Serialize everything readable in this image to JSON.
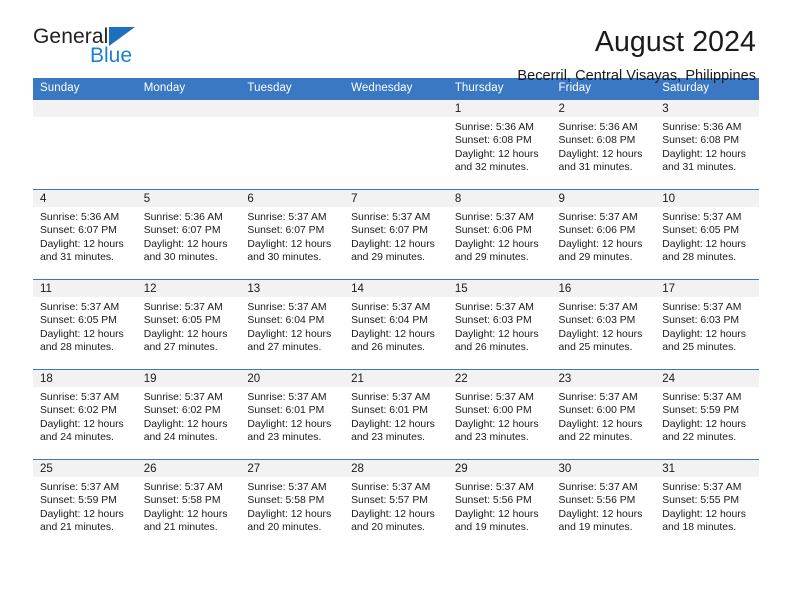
{
  "brand": {
    "name_part1": "General",
    "name_part2": "Blue",
    "triangle_color": "#1e6fbd",
    "blue_text_color": "#1e7fd4"
  },
  "header": {
    "title": "August 2024",
    "subtitle": "Becerril, Central Visayas, Philippines"
  },
  "theme": {
    "header_blue": "#3b78c3",
    "daynum_band": "#f2f2f2",
    "text": "#1a1a1a"
  },
  "weekday_headers": [
    "Sunday",
    "Monday",
    "Tuesday",
    "Wednesday",
    "Thursday",
    "Friday",
    "Saturday"
  ],
  "chart_data": {
    "type": "table",
    "title": "August 2024",
    "subtitle": "Becerril, Central Visayas, Philippines",
    "columns": [
      "Sunday",
      "Monday",
      "Tuesday",
      "Wednesday",
      "Thursday",
      "Friday",
      "Saturday"
    ],
    "weeks": [
      [
        {
          "day": "",
          "empty": true
        },
        {
          "day": "",
          "empty": true
        },
        {
          "day": "",
          "empty": true
        },
        {
          "day": "",
          "empty": true
        },
        {
          "day": "1",
          "sunrise": "Sunrise: 5:36 AM",
          "sunset": "Sunset: 6:08 PM",
          "daylight1": "Daylight: 12 hours",
          "daylight2": "and 32 minutes."
        },
        {
          "day": "2",
          "sunrise": "Sunrise: 5:36 AM",
          "sunset": "Sunset: 6:08 PM",
          "daylight1": "Daylight: 12 hours",
          "daylight2": "and 31 minutes."
        },
        {
          "day": "3",
          "sunrise": "Sunrise: 5:36 AM",
          "sunset": "Sunset: 6:08 PM",
          "daylight1": "Daylight: 12 hours",
          "daylight2": "and 31 minutes."
        }
      ],
      [
        {
          "day": "4",
          "sunrise": "Sunrise: 5:36 AM",
          "sunset": "Sunset: 6:07 PM",
          "daylight1": "Daylight: 12 hours",
          "daylight2": "and 31 minutes."
        },
        {
          "day": "5",
          "sunrise": "Sunrise: 5:36 AM",
          "sunset": "Sunset: 6:07 PM",
          "daylight1": "Daylight: 12 hours",
          "daylight2": "and 30 minutes."
        },
        {
          "day": "6",
          "sunrise": "Sunrise: 5:37 AM",
          "sunset": "Sunset: 6:07 PM",
          "daylight1": "Daylight: 12 hours",
          "daylight2": "and 30 minutes."
        },
        {
          "day": "7",
          "sunrise": "Sunrise: 5:37 AM",
          "sunset": "Sunset: 6:07 PM",
          "daylight1": "Daylight: 12 hours",
          "daylight2": "and 29 minutes."
        },
        {
          "day": "8",
          "sunrise": "Sunrise: 5:37 AM",
          "sunset": "Sunset: 6:06 PM",
          "daylight1": "Daylight: 12 hours",
          "daylight2": "and 29 minutes."
        },
        {
          "day": "9",
          "sunrise": "Sunrise: 5:37 AM",
          "sunset": "Sunset: 6:06 PM",
          "daylight1": "Daylight: 12 hours",
          "daylight2": "and 29 minutes."
        },
        {
          "day": "10",
          "sunrise": "Sunrise: 5:37 AM",
          "sunset": "Sunset: 6:05 PM",
          "daylight1": "Daylight: 12 hours",
          "daylight2": "and 28 minutes."
        }
      ],
      [
        {
          "day": "11",
          "sunrise": "Sunrise: 5:37 AM",
          "sunset": "Sunset: 6:05 PM",
          "daylight1": "Daylight: 12 hours",
          "daylight2": "and 28 minutes."
        },
        {
          "day": "12",
          "sunrise": "Sunrise: 5:37 AM",
          "sunset": "Sunset: 6:05 PM",
          "daylight1": "Daylight: 12 hours",
          "daylight2": "and 27 minutes."
        },
        {
          "day": "13",
          "sunrise": "Sunrise: 5:37 AM",
          "sunset": "Sunset: 6:04 PM",
          "daylight1": "Daylight: 12 hours",
          "daylight2": "and 27 minutes."
        },
        {
          "day": "14",
          "sunrise": "Sunrise: 5:37 AM",
          "sunset": "Sunset: 6:04 PM",
          "daylight1": "Daylight: 12 hours",
          "daylight2": "and 26 minutes."
        },
        {
          "day": "15",
          "sunrise": "Sunrise: 5:37 AM",
          "sunset": "Sunset: 6:03 PM",
          "daylight1": "Daylight: 12 hours",
          "daylight2": "and 26 minutes."
        },
        {
          "day": "16",
          "sunrise": "Sunrise: 5:37 AM",
          "sunset": "Sunset: 6:03 PM",
          "daylight1": "Daylight: 12 hours",
          "daylight2": "and 25 minutes."
        },
        {
          "day": "17",
          "sunrise": "Sunrise: 5:37 AM",
          "sunset": "Sunset: 6:03 PM",
          "daylight1": "Daylight: 12 hours",
          "daylight2": "and 25 minutes."
        }
      ],
      [
        {
          "day": "18",
          "sunrise": "Sunrise: 5:37 AM",
          "sunset": "Sunset: 6:02 PM",
          "daylight1": "Daylight: 12 hours",
          "daylight2": "and 24 minutes."
        },
        {
          "day": "19",
          "sunrise": "Sunrise: 5:37 AM",
          "sunset": "Sunset: 6:02 PM",
          "daylight1": "Daylight: 12 hours",
          "daylight2": "and 24 minutes."
        },
        {
          "day": "20",
          "sunrise": "Sunrise: 5:37 AM",
          "sunset": "Sunset: 6:01 PM",
          "daylight1": "Daylight: 12 hours",
          "daylight2": "and 23 minutes."
        },
        {
          "day": "21",
          "sunrise": "Sunrise: 5:37 AM",
          "sunset": "Sunset: 6:01 PM",
          "daylight1": "Daylight: 12 hours",
          "daylight2": "and 23 minutes."
        },
        {
          "day": "22",
          "sunrise": "Sunrise: 5:37 AM",
          "sunset": "Sunset: 6:00 PM",
          "daylight1": "Daylight: 12 hours",
          "daylight2": "and 23 minutes."
        },
        {
          "day": "23",
          "sunrise": "Sunrise: 5:37 AM",
          "sunset": "Sunset: 6:00 PM",
          "daylight1": "Daylight: 12 hours",
          "daylight2": "and 22 minutes."
        },
        {
          "day": "24",
          "sunrise": "Sunrise: 5:37 AM",
          "sunset": "Sunset: 5:59 PM",
          "daylight1": "Daylight: 12 hours",
          "daylight2": "and 22 minutes."
        }
      ],
      [
        {
          "day": "25",
          "sunrise": "Sunrise: 5:37 AM",
          "sunset": "Sunset: 5:59 PM",
          "daylight1": "Daylight: 12 hours",
          "daylight2": "and 21 minutes."
        },
        {
          "day": "26",
          "sunrise": "Sunrise: 5:37 AM",
          "sunset": "Sunset: 5:58 PM",
          "daylight1": "Daylight: 12 hours",
          "daylight2": "and 21 minutes."
        },
        {
          "day": "27",
          "sunrise": "Sunrise: 5:37 AM",
          "sunset": "Sunset: 5:58 PM",
          "daylight1": "Daylight: 12 hours",
          "daylight2": "and 20 minutes."
        },
        {
          "day": "28",
          "sunrise": "Sunrise: 5:37 AM",
          "sunset": "Sunset: 5:57 PM",
          "daylight1": "Daylight: 12 hours",
          "daylight2": "and 20 minutes."
        },
        {
          "day": "29",
          "sunrise": "Sunrise: 5:37 AM",
          "sunset": "Sunset: 5:56 PM",
          "daylight1": "Daylight: 12 hours",
          "daylight2": "and 19 minutes."
        },
        {
          "day": "30",
          "sunrise": "Sunrise: 5:37 AM",
          "sunset": "Sunset: 5:56 PM",
          "daylight1": "Daylight: 12 hours",
          "daylight2": "and 19 minutes."
        },
        {
          "day": "31",
          "sunrise": "Sunrise: 5:37 AM",
          "sunset": "Sunset: 5:55 PM",
          "daylight1": "Daylight: 12 hours",
          "daylight2": "and 18 minutes."
        }
      ]
    ]
  }
}
